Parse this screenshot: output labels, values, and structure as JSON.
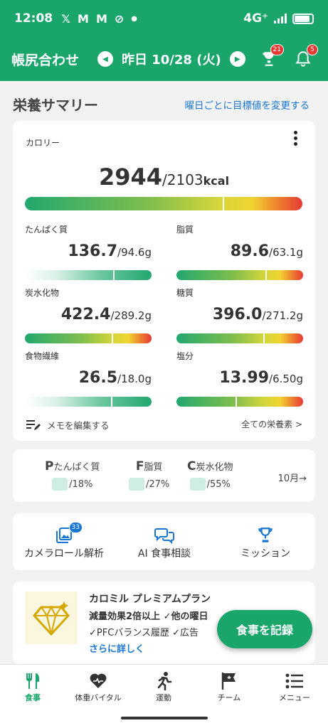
{
  "status_bar": {
    "time": "12:08",
    "icons": [
      "x-icon",
      "gmail-icon",
      "gmail-icon",
      "check-circle-icon",
      "dot-icon"
    ],
    "network": "4G⁺"
  },
  "app_bar": {
    "title": "帳尻合わせ",
    "date": "昨日 10/28 (火)",
    "trophy_badge": "21",
    "bell_badge": "5"
  },
  "section": {
    "title": "栄養サマリー",
    "change_target_link": "曜日ごとに目標値を変更する"
  },
  "calorie": {
    "label": "カロリー",
    "value": "2944",
    "target": "/2103",
    "unit": "kcal",
    "ratio": 1.4
  },
  "nutrients": [
    {
      "label": "たんぱく質",
      "value": "136.7",
      "target": "/94.6g",
      "ratio": 1.44,
      "style": "green"
    },
    {
      "label": "脂質",
      "value": "89.6",
      "target": "/63.1g",
      "ratio": 1.42,
      "style": "full"
    },
    {
      "label": "炭水化物",
      "value": "422.4",
      "target": "/289.2g",
      "ratio": 1.46,
      "style": "full"
    },
    {
      "label": "糖質",
      "value": "396.0",
      "target": "/271.2g",
      "ratio": 1.46,
      "style": "full"
    },
    {
      "label": "食物繊維",
      "value": "26.5",
      "target": "/18.0g",
      "ratio": 1.47,
      "style": "green"
    },
    {
      "label": "塩分",
      "value": "13.99",
      "target": "/6.50g",
      "ratio": 2.15,
      "style": "full"
    }
  ],
  "memo_label": "メモを編集する",
  "all_nutrients_link": "全ての栄養素 >",
  "pfc": {
    "items": [
      {
        "letter": "P",
        "label": "たんぱく質",
        "value": "/18%"
      },
      {
        "letter": "F",
        "label": "脂質",
        "value": "/27%"
      },
      {
        "letter": "C",
        "label": "炭水化物",
        "value": "/55%"
      }
    ],
    "month_link": "10月→"
  },
  "tools": [
    {
      "label": "カメラロール解析",
      "icon": "photo-library-icon",
      "badge": "33"
    },
    {
      "label": "AI 食事相談",
      "icon": "chat-bubbles-icon"
    },
    {
      "label": "ミッション",
      "icon": "trophy-icon"
    }
  ],
  "premium": {
    "title": "カロミル プレミアムプラン",
    "line1": "減量効果2倍以上 ✓他の曜日",
    "line2": "✓PFCバランス履歴 ✓広告",
    "more": "さらに詳しく"
  },
  "fab_label": "食事を記録",
  "bottom_nav": [
    {
      "label": "食事",
      "icon": "fork-knife-icon",
      "active": true
    },
    {
      "label": "体重バイタル",
      "icon": "heart-scale-icon",
      "active": false
    },
    {
      "label": "運動",
      "icon": "running-icon",
      "active": false
    },
    {
      "label": "チーム",
      "icon": "team-flag-icon",
      "active": false
    },
    {
      "label": "メニュー",
      "icon": "menu-list-icon",
      "active": false
    }
  ],
  "colors": {
    "primary": "#1aa56b",
    "link": "#1976d2",
    "badge": "#e53935"
  }
}
